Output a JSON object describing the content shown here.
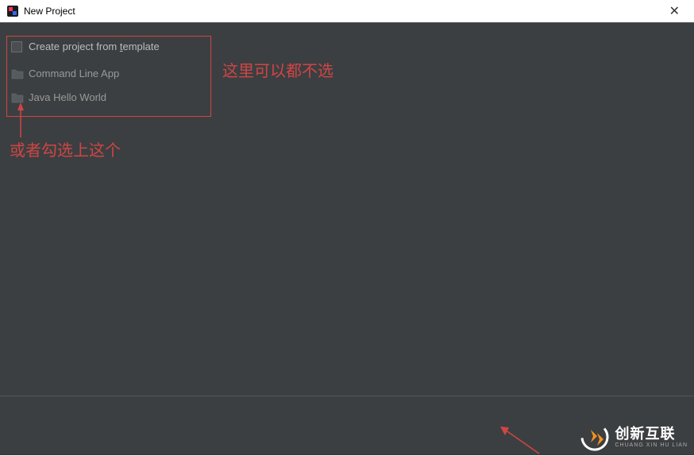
{
  "titlebar": {
    "title": "New Project"
  },
  "content": {
    "checkbox_label_pre": "Create project from ",
    "checkbox_label_underline": "t",
    "checkbox_label_post": "emplate",
    "template_items": [
      {
        "label": "Command Line App"
      },
      {
        "label": "Java Hello World"
      }
    ]
  },
  "annotations": {
    "right": "这里可以都不选",
    "below": "或者勾选上这个"
  },
  "watermark": {
    "main": "创新互联",
    "sub": "CHUANG XIN HU LIAN"
  }
}
